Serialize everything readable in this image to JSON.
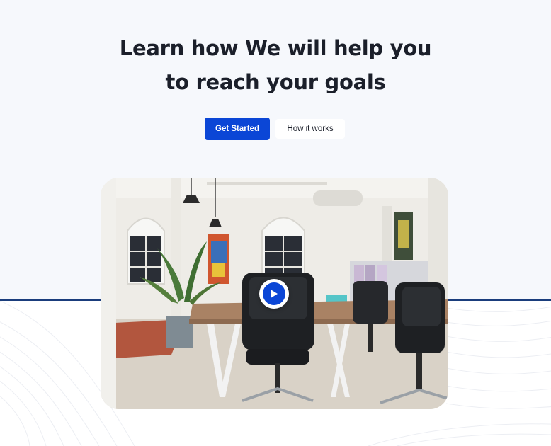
{
  "hero": {
    "title_line1": "Learn how We will help you",
    "title_line2": "to reach your goals"
  },
  "actions": {
    "primary_label": "Get Started",
    "secondary_label": "How it works"
  },
  "video": {
    "play_icon": "play-icon"
  },
  "colors": {
    "accent": "#0b46d6",
    "top_background": "#f6f8fc",
    "divider": "#1a3d7c",
    "heading": "#1b1f2a"
  }
}
